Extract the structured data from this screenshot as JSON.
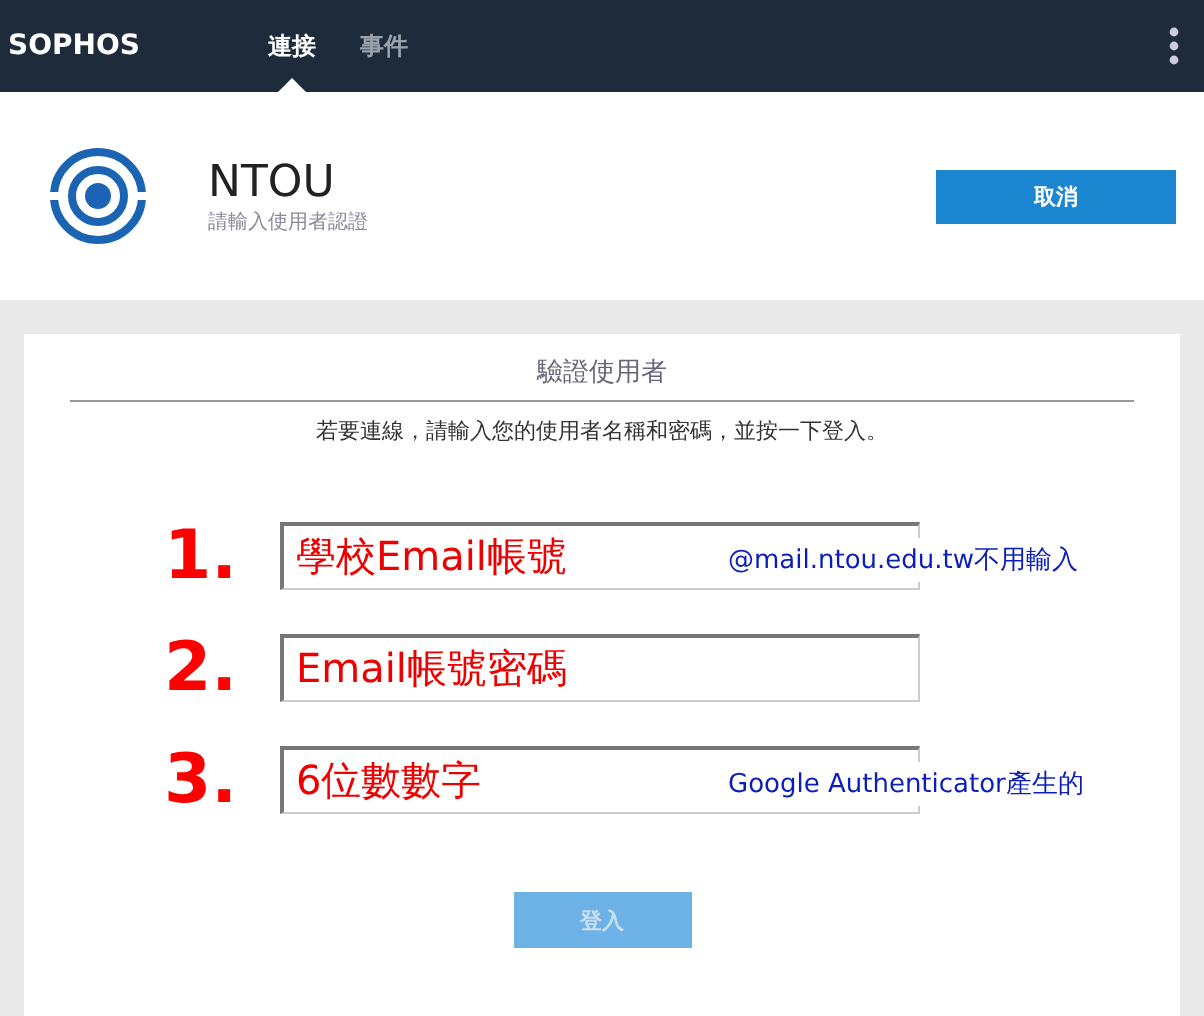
{
  "nav": {
    "brand": "SOPHOS",
    "tabs": [
      {
        "label": "連接",
        "selected": true
      },
      {
        "label": "事件",
        "selected": false
      }
    ]
  },
  "header": {
    "title": "NTOU",
    "subtitle": "請輸入使用者認證",
    "cancel": "取消"
  },
  "form": {
    "heading": "驗證使用者",
    "instruction": "若要連線，請輸入您的使用者名稱和密碼，並按一下登入。",
    "fields": [
      {
        "number": "1.",
        "value": "學校Email帳號",
        "note": "@mail.ntou.edu.tw不用輸入"
      },
      {
        "number": "2.",
        "value": "Email帳號密碼"
      },
      {
        "number": "3.",
        "value": "6位數數字",
        "note": "Google Authenticator產生的"
      }
    ],
    "login": {
      "label": "登入",
      "disabled": true
    }
  }
}
